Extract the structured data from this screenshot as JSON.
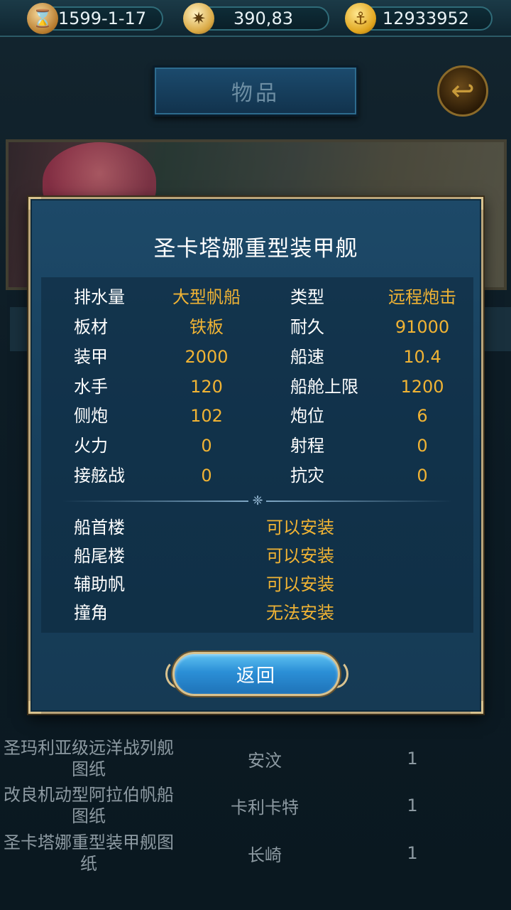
{
  "topbar": {
    "date": "1599-1-17",
    "coords": "390,83",
    "gold": "12933952",
    "icons": [
      "hourglass-icon",
      "compass-icon",
      "anchor-icon"
    ]
  },
  "header": {
    "title": "物品",
    "back_icon": "back-arrow-icon"
  },
  "background_list": {
    "rows": [
      {
        "name": "圣玛利亚级远洋战列舰图纸",
        "port": "安汶",
        "count": "1"
      },
      {
        "name": "改良机动型阿拉伯帆船图纸",
        "port": "卡利卡特",
        "count": "1"
      },
      {
        "name": "圣卡塔娜重型装甲舰图纸",
        "port": "长崎",
        "count": "1"
      }
    ]
  },
  "dialog": {
    "title": "圣卡塔娜重型装甲舰",
    "stats_left": [
      {
        "label": "排水量",
        "value": "大型帆船"
      },
      {
        "label": "板材",
        "value": "铁板"
      },
      {
        "label": "装甲",
        "value": "2000"
      },
      {
        "label": "水手",
        "value": "120"
      },
      {
        "label": "侧炮",
        "value": "102"
      },
      {
        "label": "火力",
        "value": "0"
      },
      {
        "label": "接舷战",
        "value": "0"
      }
    ],
    "stats_right": [
      {
        "label": "类型",
        "value": "远程炮击"
      },
      {
        "label": "耐久",
        "value": "91000"
      },
      {
        "label": "船速",
        "value": "10.4"
      },
      {
        "label": "船舱上限",
        "value": "1200"
      },
      {
        "label": "炮位",
        "value": "6"
      },
      {
        "label": "射程",
        "value": "0"
      },
      {
        "label": "抗灾",
        "value": "0"
      }
    ],
    "equipment": [
      {
        "label": "船首楼",
        "value": "可以安装"
      },
      {
        "label": "船尾楼",
        "value": "可以安装"
      },
      {
        "label": "辅助帆",
        "value": "可以安装"
      },
      {
        "label": "撞角",
        "value": "无法安装"
      }
    ],
    "return_label": "返回"
  },
  "colors": {
    "value_gold": "#f0b334",
    "dialog_bg": "#1d4968",
    "button_blue": "#2b8fd6"
  }
}
